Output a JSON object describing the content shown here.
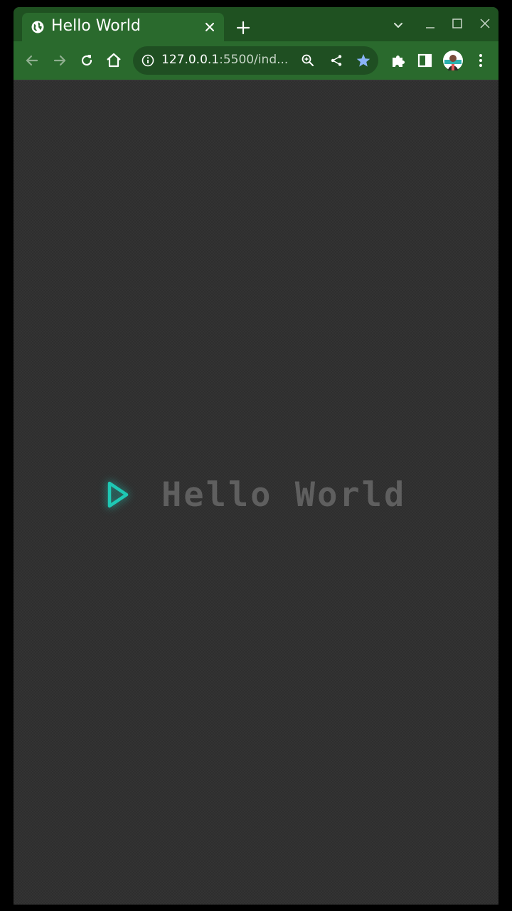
{
  "browser": {
    "tab": {
      "title": "Hello World"
    },
    "address_bar": {
      "host": "127.0.0.1",
      "rest": ":5500/ind..."
    }
  },
  "page": {
    "heading": "Hello World"
  },
  "colors": {
    "tabstrip": "#1f5121",
    "active_tab": "#2a6a2d",
    "page_background": "#2e2e2e",
    "accent": "#1ec8b4",
    "heading_text": "#5f5f5f",
    "bookmark_star": "#8ab4f8"
  },
  "icons": {
    "favicon": "globe-icon",
    "tab_close": "close-icon",
    "new_tab": "plus-icon",
    "tab_search": "chevron-down-icon",
    "minimize": "minimize-icon",
    "maximize": "maximize-icon",
    "close_window": "close-icon",
    "back": "arrow-left-icon",
    "forward": "arrow-right-icon",
    "reload": "reload-icon",
    "home": "home-icon",
    "site_info": "info-icon",
    "zoom": "zoom-icon",
    "share": "share-icon",
    "bookmark": "star-icon",
    "extensions": "puzzle-icon",
    "side_panel": "side-panel-icon",
    "profile": "avatar-icon",
    "menu": "kebab-menu-icon",
    "hero": "play-icon"
  }
}
